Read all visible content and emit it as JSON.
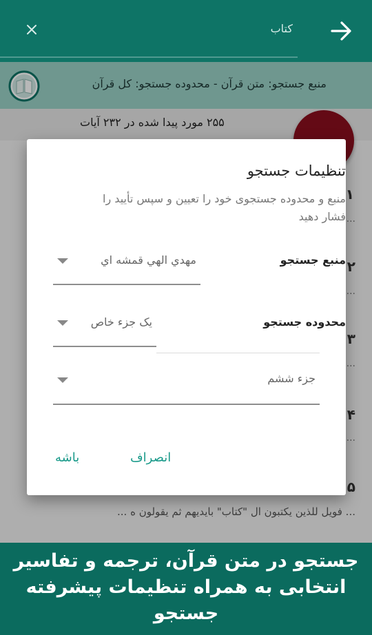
{
  "appbar": {
    "search_query": "کتاب"
  },
  "source_bar": {
    "text": "منبع جستجو: متن قرآن - محدوده جستجو: کل قرآن"
  },
  "results": {
    "count_text": "۲۵۵ مورد پیدا شده در ۲۳۲ آیات"
  },
  "list": {
    "numbers": [
      "١",
      "٢",
      "٣",
      "۴",
      "۵"
    ],
    "ellipsis": "...",
    "last_line": "... فويل للذين يكتبون ال \"كتاب\"  بايديهم ثم يقولون ه ..."
  },
  "dialog": {
    "title": "تنظیمات جستجو",
    "message": "منبع و محدوده جستجوی خود را تعیین و سپس تأیید را فشار دهید",
    "source_label": "منبع جستجو",
    "source_value": "مهدي الهي قمشه اي",
    "range_label": "محدوده جستجو",
    "range_value": "یک جزء خاص",
    "juz_value": "جزء ششم",
    "cancel_label": "انصراف",
    "ok_label": "باشه"
  },
  "banner": {
    "text": "جستجو در متن قرآن، ترجمه و تفاسیر انتخابی به همراه تنظیمات پیشرفته جستجو"
  },
  "colors": {
    "primary": "#0e7466",
    "accent": "#1a9a8a",
    "fab": "#8b0f1e",
    "source_bg": "#9ad1c6"
  }
}
